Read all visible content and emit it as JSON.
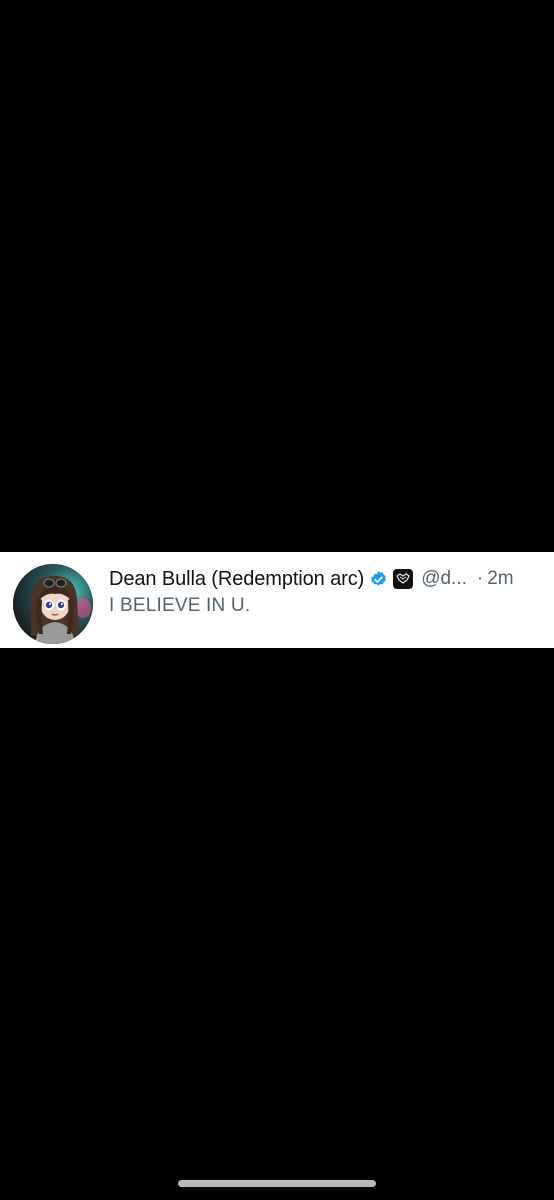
{
  "tweet": {
    "display_name": "Dean Bulla (Redemption arc)",
    "handle": "@d...",
    "separator": "·",
    "timestamp": "2m",
    "text": "I BELIEVE IN U.",
    "verified": true,
    "avatar_icon": "cartoon-avatar-icon",
    "badge_icon": "affiliate-badge-icon"
  },
  "colors": {
    "background": "#000000",
    "card": "#ffffff",
    "name": "#0f1419",
    "secondary_text": "#536471",
    "verified_blue": "#1d9bf0",
    "home_indicator": "#b9b9b9"
  }
}
